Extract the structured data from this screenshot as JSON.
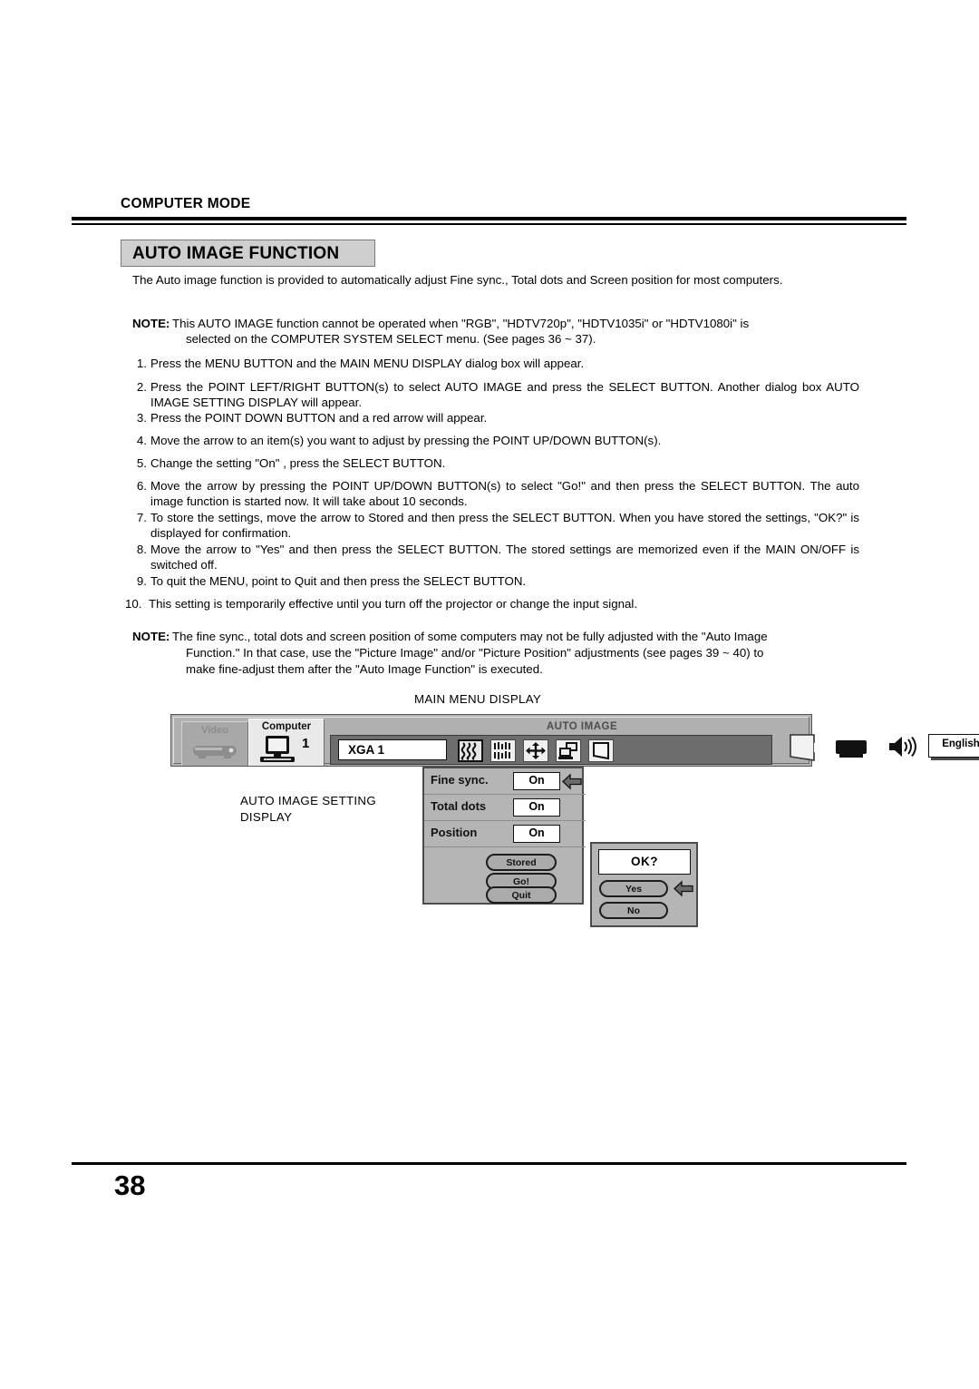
{
  "header": {
    "mode": "COMPUTER MODE",
    "title": "AUTO IMAGE FUNCTION"
  },
  "intro": "The Auto image function is provided to automatically adjust Fine sync., Total dots and Screen position for most computers.",
  "note1": {
    "label": "NOTE:",
    "line1": "This AUTO IMAGE function cannot be operated when \"RGB\", \"HDTV720p\", \"HDTV1035i\" or \"HDTV1080i\" is",
    "line2": "selected on the COMPUTER SYSTEM SELECT menu. (See pages 36 ~ 37)."
  },
  "steps": [
    {
      "n": "1.",
      "text": "Press the MENU BUTTON and the MAIN MENU DISPLAY dialog box will appear."
    },
    {
      "n": "2.",
      "text": "Press the POINT LEFT/RIGHT BUTTON(s) to select AUTO IMAGE and press the SELECT BUTTON. Another dialog box AUTO IMAGE SETTING DISPLAY will appear."
    },
    {
      "n": "3.",
      "text": "Press the POINT DOWN BUTTON and a red arrow will appear."
    },
    {
      "n": "4.",
      "text": "Move the arrow to an item(s) you want to adjust by pressing the POINT UP/DOWN BUTTON(s)."
    },
    {
      "n": "5.",
      "text": "Change the setting \"On\" , press the SELECT BUTTON."
    },
    {
      "n": "6.",
      "text": "Move the arrow by pressing the POINT UP/DOWN BUTTON(s) to select \"Go!\" and then press the SELECT BUTTON. The auto image function is started now. It will take about 10 seconds."
    },
    {
      "n": "7.",
      "text": "To store the settings, move the arrow to Stored and then press the SELECT BUTTON.  When you have stored the settings, \"OK?\" is displayed for confirmation."
    },
    {
      "n": "8.",
      "text": "Move the arrow to \"Yes\" and then press the SELECT BUTTON. The stored settings are memorized even if the MAIN ON/OFF is switched off."
    },
    {
      "n": "9.",
      "text": "To quit the MENU, point to Quit and then press the SELECT BUTTON."
    },
    {
      "n": "10.",
      "text": "This setting is temporarily effective until you turn off the projector or change the input signal."
    }
  ],
  "note2": {
    "label": "NOTE:",
    "line1": "The fine sync., total dots and screen position of some computers may not be fully adjusted with the \"Auto Image",
    "line2": "Function.\"  In that case, use the \"Picture Image\" and/or \"Picture Position\" adjustments (see pages 39 ~ 40) to",
    "line3": "make fine-adjust them after the \"Auto Image Function\" is executed."
  },
  "captions": {
    "main_menu": "MAIN MENU DISPLAY",
    "setting_line1": "AUTO IMAGE SETTING",
    "setting_line2": "DISPLAY"
  },
  "osd": {
    "tab_video": "Video",
    "tab_computer": "Computer",
    "computer_number": "1",
    "menu_title": "AUTO IMAGE",
    "source_value": "XGA 1",
    "language_value": "English",
    "icons": [
      {
        "name": "fine-sync-icon",
        "selected": true
      },
      {
        "name": "total-dots-icon",
        "selected": false
      },
      {
        "name": "position-icon",
        "selected": false
      },
      {
        "name": "pc-adjust-icon",
        "selected": false
      },
      {
        "name": "screen-icon",
        "selected": false
      }
    ],
    "setting_dialog": {
      "rows": [
        {
          "label": "Fine sync.",
          "value": "On",
          "arrow": true
        },
        {
          "label": "Total dots",
          "value": "On",
          "arrow": false
        },
        {
          "label": "Position",
          "value": "On",
          "arrow": false
        }
      ],
      "buttons": [
        "Stored",
        "Go!",
        "Quit"
      ]
    },
    "ok_dialog": {
      "title": "OK?",
      "buttons": [
        {
          "label": "Yes",
          "arrow": true
        },
        {
          "label": "No",
          "arrow": false
        }
      ]
    }
  },
  "footer": {
    "page_number": "38"
  }
}
